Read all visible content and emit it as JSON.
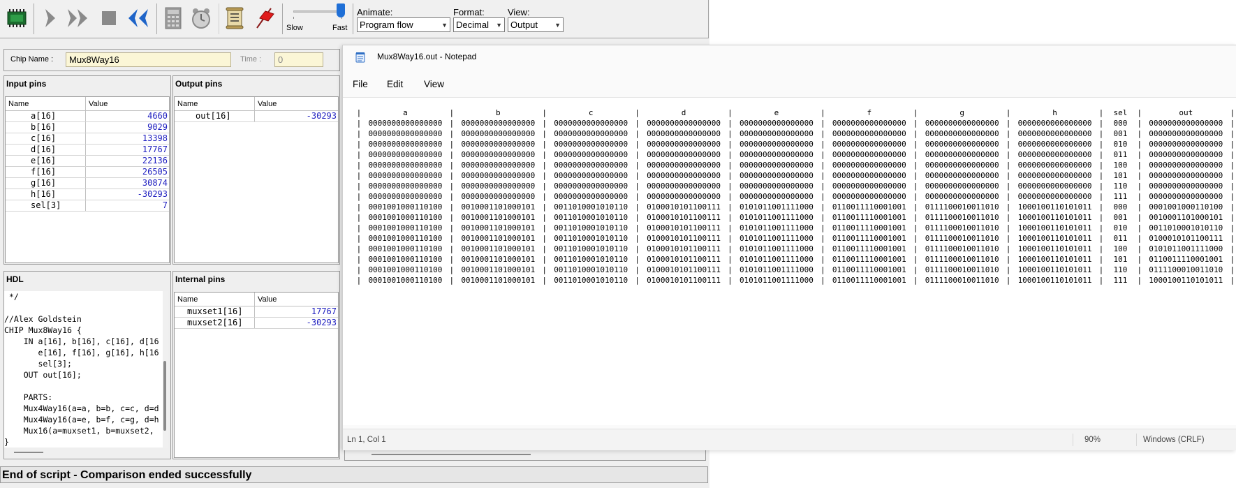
{
  "toolbar": {
    "speed": {
      "slow_label": "Slow",
      "fast_label": "Fast",
      "level": 1.0
    },
    "animate": {
      "label": "Animate:",
      "value": "Program flow"
    },
    "format": {
      "label": "Format:",
      "value": "Decimal"
    },
    "view": {
      "label": "View:",
      "value": "Output"
    },
    "icons": [
      "chip-icon",
      "single-step-icon",
      "fast-forward-icon",
      "stop-icon",
      "rewind-icon",
      "calculator-icon",
      "clock-icon",
      "script-icon",
      "breakpoint-flag-icon"
    ]
  },
  "chip": {
    "name_label": "Chip Name :",
    "name": "Mux8Way16",
    "time_label": "Time :",
    "time": "0"
  },
  "input_pins": {
    "title": "Input pins",
    "col_name": "Name",
    "col_value": "Value",
    "rows": [
      {
        "name": "a[16]",
        "value": "4660"
      },
      {
        "name": "b[16]",
        "value": "9029"
      },
      {
        "name": "c[16]",
        "value": "13398"
      },
      {
        "name": "d[16]",
        "value": "17767"
      },
      {
        "name": "e[16]",
        "value": "22136"
      },
      {
        "name": "f[16]",
        "value": "26505"
      },
      {
        "name": "g[16]",
        "value": "30874"
      },
      {
        "name": "h[16]",
        "value": "-30293"
      },
      {
        "name": "sel[3]",
        "value": "7"
      }
    ]
  },
  "output_pins": {
    "title": "Output pins",
    "col_name": "Name",
    "col_value": "Value",
    "rows": [
      {
        "name": "out[16]",
        "value": "-30293"
      }
    ]
  },
  "hdl": {
    "title": "HDL",
    "lines": [
      " */",
      "",
      "//Alex Goldstein",
      "CHIP Mux8Way16 {",
      "    IN a[16], b[16], c[16], d[16",
      "       e[16], f[16], g[16], h[16",
      "       sel[3];",
      "    OUT out[16];",
      "",
      "    PARTS:",
      "    Mux4Way16(a=a, b=b, c=c, d=d",
      "    Mux4Way16(a=e, b=f, c=g, d=h",
      "    Mux16(a=muxset1, b=muxset2,",
      "}"
    ]
  },
  "internal_pins": {
    "title": "Internal pins",
    "col_name": "Name",
    "col_value": "Value",
    "rows": [
      {
        "name": "muxset1[16]",
        "value": "17767"
      },
      {
        "name": "muxset2[16]",
        "value": "-30293"
      }
    ]
  },
  "status_message": "End of script - Comparison ended successfully",
  "notepad": {
    "title": "Mux8Way16.out - Notepad",
    "menu": [
      "File",
      "Edit",
      "View"
    ],
    "status": {
      "position": "Ln 1, Col 1",
      "zoom": "90%",
      "line_ending": "Windows (CRLF)"
    },
    "columns": [
      "a",
      "b",
      "c",
      "d",
      "e",
      "f",
      "g",
      "h",
      "sel",
      "out"
    ],
    "rows": [
      [
        "0000000000000000",
        "0000000000000000",
        "0000000000000000",
        "0000000000000000",
        "0000000000000000",
        "0000000000000000",
        "0000000000000000",
        "0000000000000000",
        "000",
        "0000000000000000"
      ],
      [
        "0000000000000000",
        "0000000000000000",
        "0000000000000000",
        "0000000000000000",
        "0000000000000000",
        "0000000000000000",
        "0000000000000000",
        "0000000000000000",
        "001",
        "0000000000000000"
      ],
      [
        "0000000000000000",
        "0000000000000000",
        "0000000000000000",
        "0000000000000000",
        "0000000000000000",
        "0000000000000000",
        "0000000000000000",
        "0000000000000000",
        "010",
        "0000000000000000"
      ],
      [
        "0000000000000000",
        "0000000000000000",
        "0000000000000000",
        "0000000000000000",
        "0000000000000000",
        "0000000000000000",
        "0000000000000000",
        "0000000000000000",
        "011",
        "0000000000000000"
      ],
      [
        "0000000000000000",
        "0000000000000000",
        "0000000000000000",
        "0000000000000000",
        "0000000000000000",
        "0000000000000000",
        "0000000000000000",
        "0000000000000000",
        "100",
        "0000000000000000"
      ],
      [
        "0000000000000000",
        "0000000000000000",
        "0000000000000000",
        "0000000000000000",
        "0000000000000000",
        "0000000000000000",
        "0000000000000000",
        "0000000000000000",
        "101",
        "0000000000000000"
      ],
      [
        "0000000000000000",
        "0000000000000000",
        "0000000000000000",
        "0000000000000000",
        "0000000000000000",
        "0000000000000000",
        "0000000000000000",
        "0000000000000000",
        "110",
        "0000000000000000"
      ],
      [
        "0000000000000000",
        "0000000000000000",
        "0000000000000000",
        "0000000000000000",
        "0000000000000000",
        "0000000000000000",
        "0000000000000000",
        "0000000000000000",
        "111",
        "0000000000000000"
      ],
      [
        "0001001000110100",
        "0010001101000101",
        "0011010001010110",
        "0100010101100111",
        "0101011001111000",
        "0110011110001001",
        "0111100010011010",
        "1000100110101011",
        "000",
        "0001001000110100"
      ],
      [
        "0001001000110100",
        "0010001101000101",
        "0011010001010110",
        "0100010101100111",
        "0101011001111000",
        "0110011110001001",
        "0111100010011010",
        "1000100110101011",
        "001",
        "0010001101000101"
      ],
      [
        "0001001000110100",
        "0010001101000101",
        "0011010001010110",
        "0100010101100111",
        "0101011001111000",
        "0110011110001001",
        "0111100010011010",
        "1000100110101011",
        "010",
        "0011010001010110"
      ],
      [
        "0001001000110100",
        "0010001101000101",
        "0011010001010110",
        "0100010101100111",
        "0101011001111000",
        "0110011110001001",
        "0111100010011010",
        "1000100110101011",
        "011",
        "0100010101100111"
      ],
      [
        "0001001000110100",
        "0010001101000101",
        "0011010001010110",
        "0100010101100111",
        "0101011001111000",
        "0110011110001001",
        "0111100010011010",
        "1000100110101011",
        "100",
        "0101011001111000"
      ],
      [
        "0001001000110100",
        "0010001101000101",
        "0011010001010110",
        "0100010101100111",
        "0101011001111000",
        "0110011110001001",
        "0111100010011010",
        "1000100110101011",
        "101",
        "0110011110001001"
      ],
      [
        "0001001000110100",
        "0010001101000101",
        "0011010001010110",
        "0100010101100111",
        "0101011001111000",
        "0110011110001001",
        "0111100010011010",
        "1000100110101011",
        "110",
        "0111100010011010"
      ],
      [
        "0001001000110100",
        "0010001101000101",
        "0011010001010110",
        "0100010101100111",
        "0101011001111000",
        "0110011110001001",
        "0111100010011010",
        "1000100110101011",
        "111",
        "1000100110101011"
      ]
    ]
  }
}
